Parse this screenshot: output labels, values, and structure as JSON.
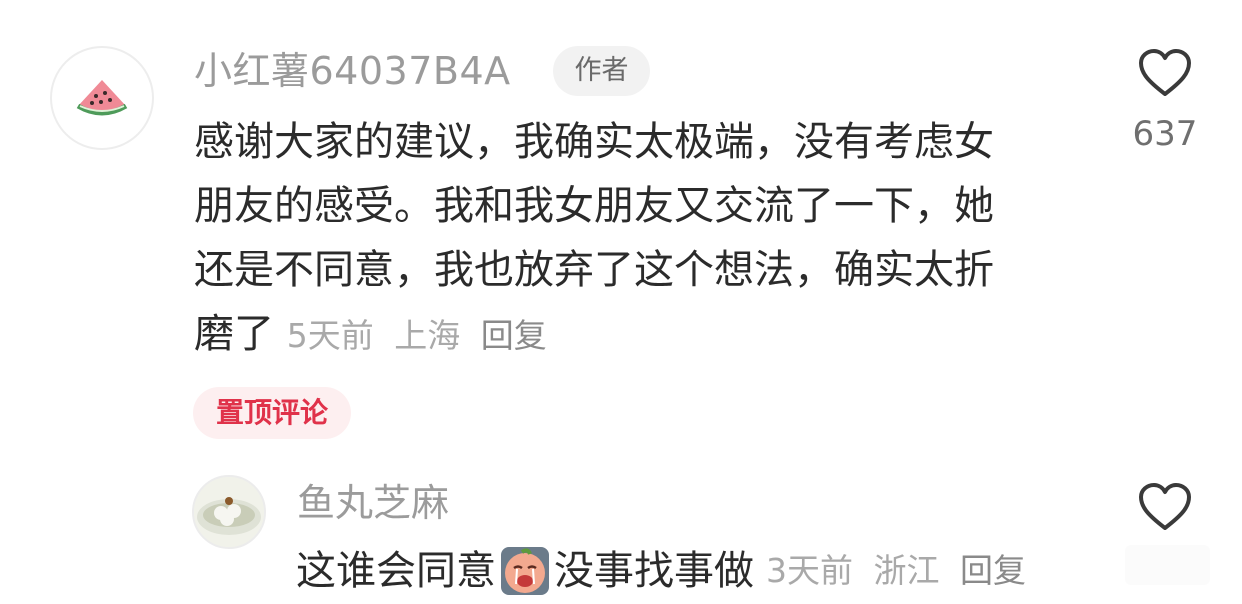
{
  "comment": {
    "avatar_icon": "watermelon-icon",
    "username": "小红薯64037B4A",
    "author_badge": "作者",
    "text_lines": [
      "感谢大家的建议，我确实太极端，没有考虑女",
      "朋友的感受。我和我女朋友又交流了一下，她",
      "还是不同意，我也放弃了这个想法，确实太折",
      "磨了"
    ],
    "time": "5天前",
    "location": "上海",
    "reply_label": "回复",
    "like_icon": "heart-outline-icon",
    "likes": "637"
  },
  "pinned_label": "置顶评论",
  "reply": {
    "avatar_icon": "dumpling-soup-icon",
    "username": "鱼丸芝麻",
    "text_before": "这谁会同意",
    "emoji_icon": "crying-face-emoji-icon",
    "text_after": "没事找事做",
    "time": "3天前",
    "location": "浙江",
    "reply_label": "回复",
    "like_icon": "heart-outline-icon"
  }
}
